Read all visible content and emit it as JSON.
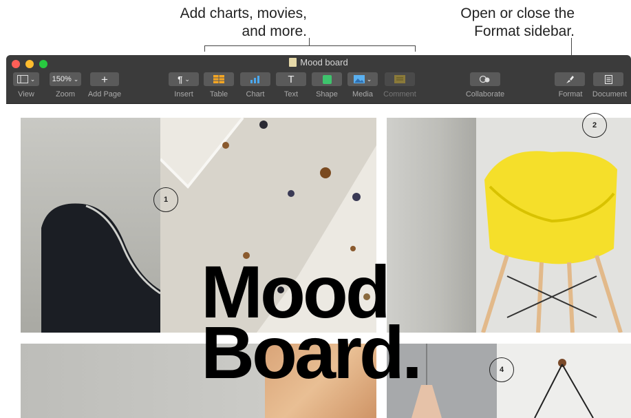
{
  "callouts": {
    "left": [
      "Add charts, movies,",
      "and more."
    ],
    "right": [
      "Open or close the",
      "Format sidebar."
    ]
  },
  "window": {
    "title": "Mood board",
    "traffic_lights": {
      "close": "#ff5f57",
      "minimize": "#febc2e",
      "zoom": "#28c840"
    }
  },
  "toolbar": {
    "view": {
      "label": "View"
    },
    "zoom": {
      "label": "Zoom",
      "value": "150%"
    },
    "add_page": {
      "label": "Add Page"
    },
    "insert": {
      "label": "Insert"
    },
    "table": {
      "label": "Table"
    },
    "chart": {
      "label": "Chart"
    },
    "text": {
      "label": "Text"
    },
    "shape": {
      "label": "Shape"
    },
    "media": {
      "label": "Media"
    },
    "comment": {
      "label": "Comment"
    },
    "collaborate": {
      "label": "Collaborate"
    },
    "format": {
      "label": "Format"
    },
    "document": {
      "label": "Document"
    }
  },
  "canvas": {
    "headline": [
      "Mood",
      "Board."
    ],
    "badges": [
      "1",
      "2",
      "4"
    ]
  }
}
